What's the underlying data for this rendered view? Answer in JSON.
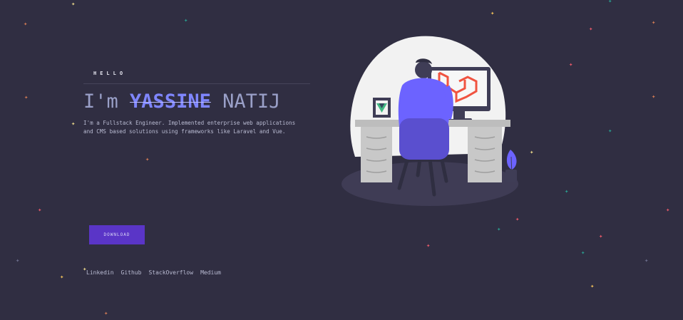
{
  "hero": {
    "greeting": "HELLO",
    "title_prefix": "I'm",
    "first_name": "YASSINE",
    "last_name": "NATIJ",
    "description_line1": "I'm a Fullstack Engineer. Implemented enterprise web applications",
    "description_line2": "and CMS based solutions using frameworks like Laravel and Vue."
  },
  "cta": {
    "download_label": "DOWNLOAD"
  },
  "social_links": [
    "Linkedin",
    "Github",
    "StackOverflow",
    "Medium"
  ],
  "colors": {
    "background": "#302e42",
    "accent": "#5a35c7",
    "name_highlight": "#7f86ff",
    "laravel": "#f05340",
    "vue": "#41b883"
  },
  "illustration": {
    "subject": "developer-at-desk-illustration"
  }
}
